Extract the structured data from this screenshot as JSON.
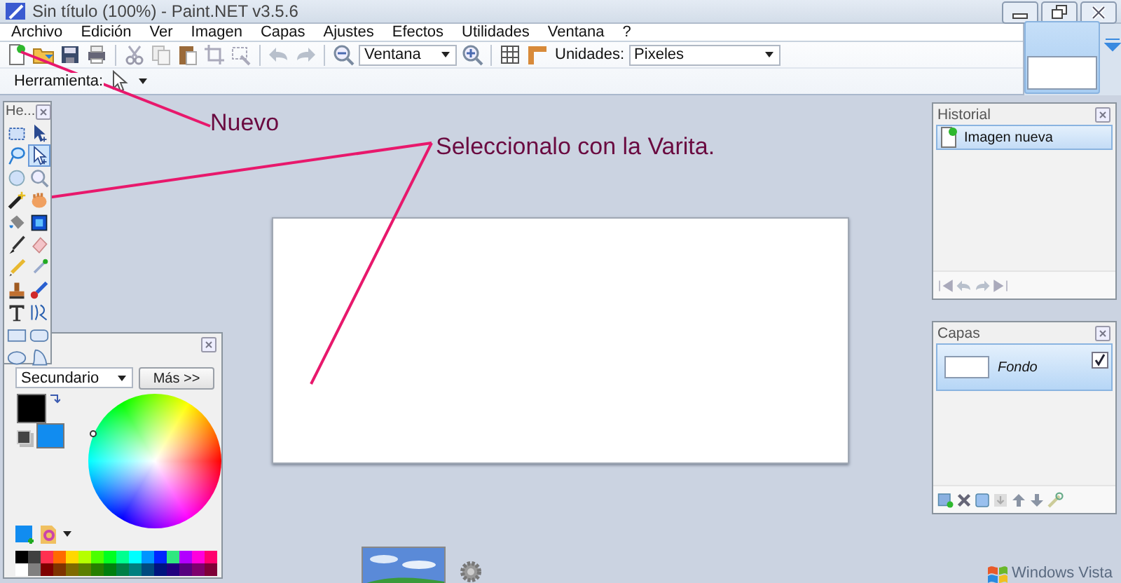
{
  "window": {
    "title": "Sin título (100%) - Paint.NET v3.5.6"
  },
  "menu": [
    "Archivo",
    "Edición",
    "Ver",
    "Imagen",
    "Capas",
    "Ajustes",
    "Efectos",
    "Utilidades",
    "Ventana",
    "?"
  ],
  "toolbar": {
    "zoom": "Ventana",
    "units_label": "Unidades:",
    "units": "Pixeles"
  },
  "tool_bar": {
    "label": "Herramienta:"
  },
  "tools_window": {
    "title": "He...",
    "tools": [
      {
        "selected": false
      },
      {
        "selected": false
      },
      {
        "selected": false
      },
      {
        "selected": true
      },
      {
        "selected": false
      },
      {
        "selected": false
      },
      {
        "selected": false
      },
      {
        "selected": false
      },
      {
        "selected": false
      },
      {
        "selected": false
      },
      {
        "selected": false
      },
      {
        "selected": false
      },
      {
        "selected": false
      },
      {
        "selected": false
      },
      {
        "selected": false
      },
      {
        "selected": false
      },
      {
        "selected": false
      },
      {
        "selected": false
      },
      {
        "selected": false
      },
      {
        "selected": false
      },
      {
        "selected": false
      },
      {
        "selected": false
      }
    ]
  },
  "colors_window": {
    "mode": "Secundario",
    "more_button": "Más >>",
    "active_colors": [
      {
        "color": "#000000"
      },
      {
        "color": "#118cf0"
      }
    ],
    "palette": [
      {
        "color": "#000000"
      },
      {
        "color": "#404040"
      },
      {
        "color": "#ff3050"
      },
      {
        "color": "#ff6a00"
      },
      {
        "color": "#ffd800"
      },
      {
        "color": "#b6ff00"
      },
      {
        "color": "#4cff00"
      },
      {
        "color": "#00ff21"
      },
      {
        "color": "#00ff90"
      },
      {
        "color": "#00ffff"
      },
      {
        "color": "#0094ff"
      },
      {
        "color": "#0026ff"
      },
      {
        "color": "#30e880"
      },
      {
        "color": "#b200ff"
      },
      {
        "color": "#ff00dc"
      },
      {
        "color": "#ff006e"
      },
      {
        "color": "#ffffff"
      },
      {
        "color": "#808080"
      },
      {
        "color": "#7f0000"
      },
      {
        "color": "#7f3300"
      },
      {
        "color": "#7f6a00"
      },
      {
        "color": "#5b7f00"
      },
      {
        "color": "#267f00"
      },
      {
        "color": "#007f0e"
      },
      {
        "color": "#007f46"
      },
      {
        "color": "#007f7f"
      },
      {
        "color": "#004a7f"
      },
      {
        "color": "#00137f"
      },
      {
        "color": "#21007f"
      },
      {
        "color": "#57007f"
      },
      {
        "color": "#7f006e"
      },
      {
        "color": "#7f0037"
      }
    ]
  },
  "history_window": {
    "title": "Historial",
    "items": [
      {
        "label": "Imagen nueva",
        "selected": true
      }
    ]
  },
  "layers_window": {
    "title": "Capas",
    "layers": [
      {
        "name": "Fondo",
        "visible": true,
        "selected": true
      }
    ]
  },
  "annotations": [
    {
      "text": "Nuevo"
    },
    {
      "text": "Seleccionalo con la Varita."
    }
  ],
  "taskbar": {
    "logo_text": "Windows Vista"
  }
}
